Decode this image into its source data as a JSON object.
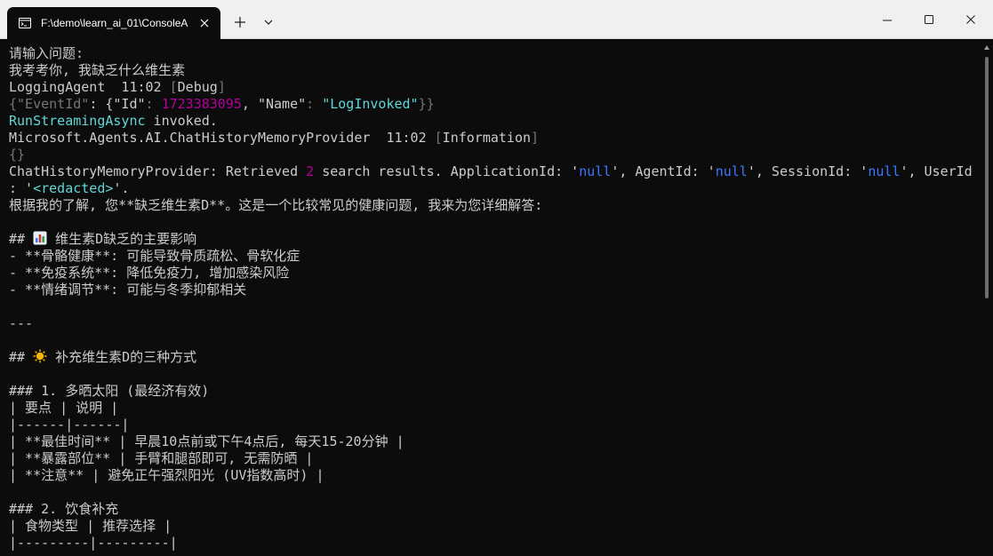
{
  "tab": {
    "title": "F:\\demo\\learn_ai_01\\ConsoleA",
    "icon": "terminal-icon"
  },
  "window_controls": {
    "new_tab_icon": "plus-icon",
    "dropdown_icon": "chevron-down-icon",
    "minimize_icon": "minimize-icon",
    "maximize_icon": "maximize-icon",
    "close_icon": "close-icon"
  },
  "console": {
    "l01": "请输入问题:",
    "l02": "我考考你, 我缺乏什么维生素",
    "l03_a": "LoggingAgent  11:02 ",
    "l03_b": "[",
    "l03_c": "Debug",
    "l03_d": "]",
    "l04_a": "{\"EventId\"",
    "l04_b": ": {\"Id\"",
    "l04_c": ": ",
    "l04_d": "1723383095",
    "l04_e": ", \"Name\"",
    "l04_f": ": ",
    "l04_g": "\"LogInvoked\"",
    "l04_h": "}}",
    "l05_a": "RunStreamingAsync",
    "l05_b": " invoked.",
    "l06_a": "Microsoft.Agents.AI.ChatHistoryMemoryProvider  11:02 ",
    "l06_b": "[",
    "l06_c": "Information",
    "l06_d": "]",
    "l07": "{}",
    "l08_a": "ChatHistoryMemoryProvider: Retrieved ",
    "l08_b": "2",
    "l08_c": " search results. ApplicationId: '",
    "l08_d": "null",
    "l08_e": "', AgentId: '",
    "l08_f": "null",
    "l08_g": "', SessionId: '",
    "l08_h": "null",
    "l08_i": "', UserId",
    "l09_a": ": '",
    "l09_b": "<redacted>",
    "l09_c": "'.",
    "l10": "根据我的了解, 您**缺乏维生素D**。这是一个比较常见的健康问题, 我来为您详细解答:",
    "l11": "",
    "l12_a": "## ",
    "l12_b": " 维生素D缺乏的主要影响",
    "l13": "- **骨骼健康**: 可能导致骨质疏松、骨软化症",
    "l14": "- **免疫系统**: 降低免疫力, 增加感染风险",
    "l15": "- **情绪调节**: 可能与冬季抑郁相关",
    "l16": "",
    "l17": "---",
    "l18": "",
    "l19_a": "## ",
    "l19_b": " 补充维生素D的三种方式",
    "l20": "",
    "l21": "### 1. 多晒太阳 (最经济有效)",
    "l22": "| 要点 | 说明 |",
    "l23": "|------|------|",
    "l24": "| **最佳时间** | 早晨10点前或下午4点后, 每天15-20分钟 |",
    "l25": "| **暴露部位** | 手臂和腿部即可, 无需防晒 |",
    "l26": "| **注意** | 避免正午强烈阳光 (UV指数高时) |",
    "l27": "",
    "l28": "### 2. 饮食补充",
    "l29": "| 食物类型 | 推荐选择 |",
    "l30": "|---------|---------|"
  }
}
